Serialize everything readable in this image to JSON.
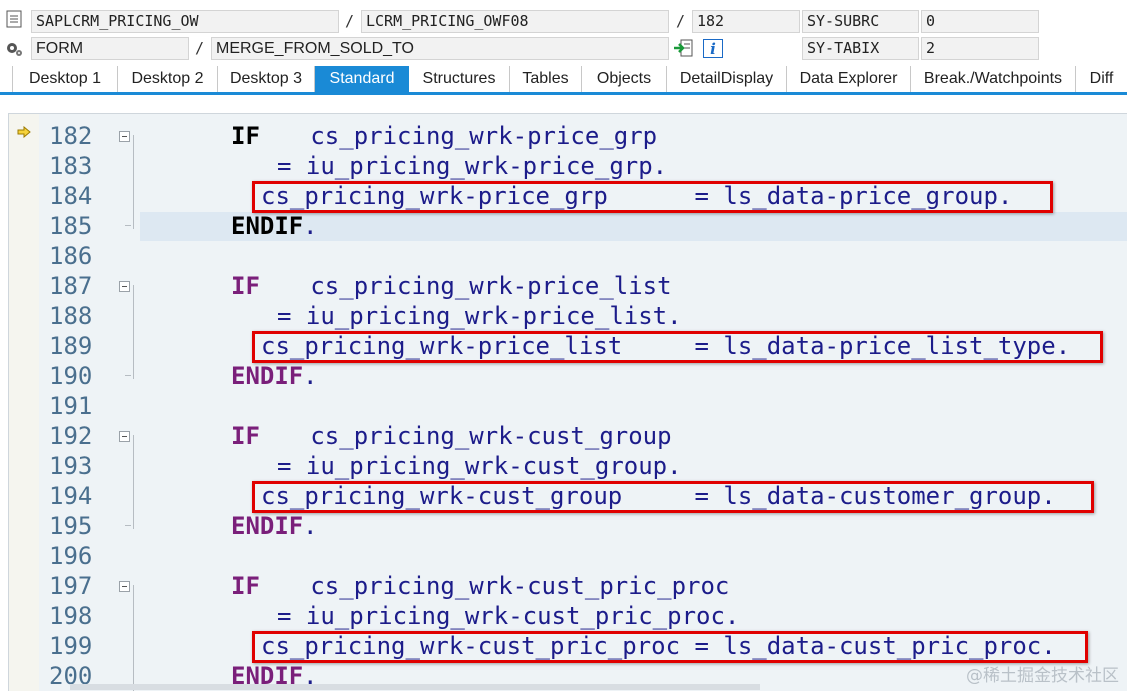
{
  "header": {
    "program": "SAPLCRM_PRICING_OW",
    "include": "LCRM_PRICING_OWF08",
    "line": "182",
    "event_type": "FORM",
    "event_name": "MERGE_FROM_SOLD_TO",
    "sysvar1_name": "SY-SUBRC",
    "sysvar1_value": "0",
    "sysvar2_name": "SY-TABIX",
    "sysvar2_value": "2",
    "slash": "/",
    "info_glyph": "i"
  },
  "tabs": [
    {
      "label": "Desktop 1"
    },
    {
      "label": "Desktop 2"
    },
    {
      "label": "Desktop 3"
    },
    {
      "label": "Standard"
    },
    {
      "label": "Structures"
    },
    {
      "label": "Tables"
    },
    {
      "label": "Objects"
    },
    {
      "label": "DetailDisplay"
    },
    {
      "label": "Data Explorer"
    },
    {
      "label": "Break./Watchpoints"
    },
    {
      "label": "Diff"
    }
  ],
  "active_tab": "Standard",
  "code": {
    "current_line": "185",
    "lines": [
      {
        "num": "182",
        "kw": "IF",
        "text": "   cs_pricing_wrk-price_grp"
      },
      {
        "num": "183",
        "text": "= iu_pricing_wrk-price_grp."
      },
      {
        "num": "184",
        "text": "cs_pricing_wrk-price_grp      = ls_data-price_group."
      },
      {
        "num": "185",
        "kw": "ENDIF",
        "text": "."
      },
      {
        "num": "186",
        "text": ""
      },
      {
        "num": "187",
        "kw": "IF",
        "text": "   cs_pricing_wrk-price_list"
      },
      {
        "num": "188",
        "text": "= iu_pricing_wrk-price_list."
      },
      {
        "num": "189",
        "text": "cs_pricing_wrk-price_list     = ls_data-price_list_type."
      },
      {
        "num": "190",
        "kw": "ENDIF",
        "text": "."
      },
      {
        "num": "191",
        "text": ""
      },
      {
        "num": "192",
        "kw": "IF",
        "text": "   cs_pricing_wrk-cust_group"
      },
      {
        "num": "193",
        "text": "= iu_pricing_wrk-cust_group."
      },
      {
        "num": "194",
        "text": "cs_pricing_wrk-cust_group     = ls_data-customer_group."
      },
      {
        "num": "195",
        "kw": "ENDIF",
        "text": "."
      },
      {
        "num": "196",
        "text": ""
      },
      {
        "num": "197",
        "kw": "IF",
        "text": "   cs_pricing_wrk-cust_pric_proc"
      },
      {
        "num": "198",
        "text": "= iu_pricing_wrk-cust_pric_proc."
      },
      {
        "num": "199",
        "text": "cs_pricing_wrk-cust_pric_proc = ls_data-cust_pric_proc."
      },
      {
        "num": "200",
        "kw": "ENDIF",
        "text": "."
      }
    ]
  },
  "watermark": "@稀土掘金技术社区",
  "colors": {
    "accent": "#1a8ad6",
    "highlight_box": "#e00000",
    "keyword_if": "#000000",
    "keyword_endif": "#7a1f7a",
    "identifier": "#1c1c8a",
    "line_number": "#4a6f8e"
  }
}
